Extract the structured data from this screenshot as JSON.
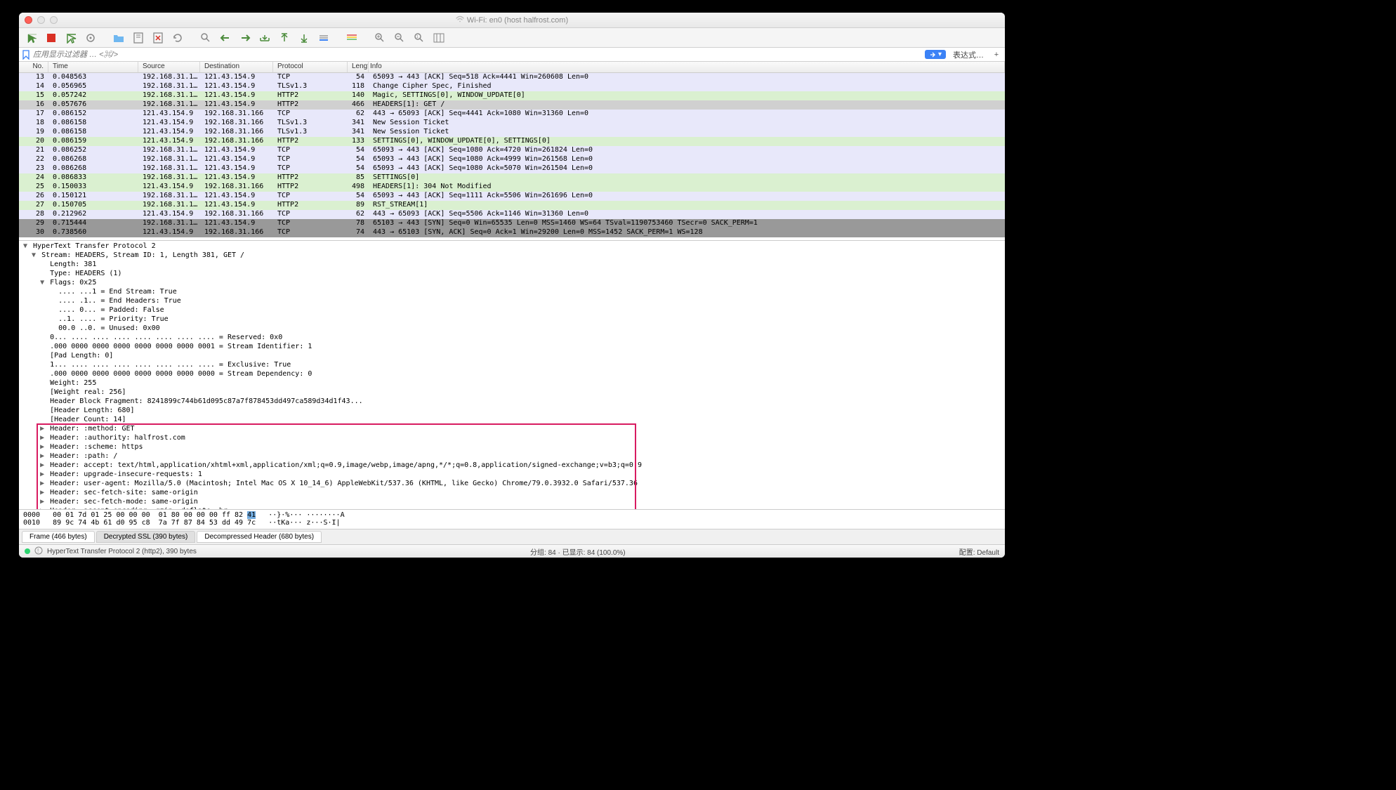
{
  "title": "Wi-Fi: en0 (host halfrost.com)",
  "filter_placeholder": "应用显示过滤器 … <⌘/>",
  "expr_label": "表达式…",
  "columns": [
    "No.",
    "Time",
    "Source",
    "Destination",
    "Protocol",
    "Length",
    "Info"
  ],
  "packets": [
    {
      "no": 13,
      "time": "0.048563",
      "src": "192.168.31.1…",
      "dst": "121.43.154.9",
      "proto": "TCP",
      "len": 54,
      "info": "65093 → 443 [ACK] Seq=518 Ack=4441 Win=260608 Len=0",
      "bg": "lav"
    },
    {
      "no": 14,
      "time": "0.056965",
      "src": "192.168.31.1…",
      "dst": "121.43.154.9",
      "proto": "TLSv1.3",
      "len": 118,
      "info": "Change Cipher Spec, Finished",
      "bg": "lav"
    },
    {
      "no": 15,
      "time": "0.057242",
      "src": "192.168.31.1…",
      "dst": "121.43.154.9",
      "proto": "HTTP2",
      "len": 140,
      "info": "Magic, SETTINGS[0], WINDOW_UPDATE[0]",
      "bg": "gr"
    },
    {
      "no": 16,
      "time": "0.057676",
      "src": "192.168.31.1…",
      "dst": "121.43.154.9",
      "proto": "HTTP2",
      "len": 466,
      "info": "HEADERS[1]: GET /",
      "bg": "sel"
    },
    {
      "no": 17,
      "time": "0.086152",
      "src": "121.43.154.9",
      "dst": "192.168.31.166",
      "proto": "TCP",
      "len": 62,
      "info": "443 → 65093 [ACK] Seq=4441 Ack=1080 Win=31360 Len=0",
      "bg": "lav"
    },
    {
      "no": 18,
      "time": "0.086158",
      "src": "121.43.154.9",
      "dst": "192.168.31.166",
      "proto": "TLSv1.3",
      "len": 341,
      "info": "New Session Ticket",
      "bg": "lav"
    },
    {
      "no": 19,
      "time": "0.086158",
      "src": "121.43.154.9",
      "dst": "192.168.31.166",
      "proto": "TLSv1.3",
      "len": 341,
      "info": "New Session Ticket",
      "bg": "lav"
    },
    {
      "no": 20,
      "time": "0.086159",
      "src": "121.43.154.9",
      "dst": "192.168.31.166",
      "proto": "HTTP2",
      "len": 133,
      "info": "SETTINGS[0], WINDOW_UPDATE[0], SETTINGS[0]",
      "bg": "gr"
    },
    {
      "no": 21,
      "time": "0.086252",
      "src": "192.168.31.1…",
      "dst": "121.43.154.9",
      "proto": "TCP",
      "len": 54,
      "info": "65093 → 443 [ACK] Seq=1080 Ack=4720 Win=261824 Len=0",
      "bg": "lav"
    },
    {
      "no": 22,
      "time": "0.086268",
      "src": "192.168.31.1…",
      "dst": "121.43.154.9",
      "proto": "TCP",
      "len": 54,
      "info": "65093 → 443 [ACK] Seq=1080 Ack=4999 Win=261568 Len=0",
      "bg": "lav"
    },
    {
      "no": 23,
      "time": "0.086268",
      "src": "192.168.31.1…",
      "dst": "121.43.154.9",
      "proto": "TCP",
      "len": 54,
      "info": "65093 → 443 [ACK] Seq=1080 Ack=5070 Win=261504 Len=0",
      "bg": "lav"
    },
    {
      "no": 24,
      "time": "0.086833",
      "src": "192.168.31.1…",
      "dst": "121.43.154.9",
      "proto": "HTTP2",
      "len": 85,
      "info": "SETTINGS[0]",
      "bg": "gr"
    },
    {
      "no": 25,
      "time": "0.150033",
      "src": "121.43.154.9",
      "dst": "192.168.31.166",
      "proto": "HTTP2",
      "len": 498,
      "info": "HEADERS[1]: 304 Not Modified",
      "bg": "gr"
    },
    {
      "no": 26,
      "time": "0.150121",
      "src": "192.168.31.1…",
      "dst": "121.43.154.9",
      "proto": "TCP",
      "len": 54,
      "info": "65093 → 443 [ACK] Seq=1111 Ack=5506 Win=261696 Len=0",
      "bg": "lav"
    },
    {
      "no": 27,
      "time": "0.150705",
      "src": "192.168.31.1…",
      "dst": "121.43.154.9",
      "proto": "HTTP2",
      "len": 89,
      "info": "RST_STREAM[1]",
      "bg": "gr"
    },
    {
      "no": 28,
      "time": "0.212962",
      "src": "121.43.154.9",
      "dst": "192.168.31.166",
      "proto": "TCP",
      "len": 62,
      "info": "443 → 65093 [ACK] Seq=5506 Ack=1146 Win=31360 Len=0",
      "bg": "lav"
    },
    {
      "no": 29,
      "time": "0.715444",
      "src": "192.168.31.1…",
      "dst": "121.43.154.9",
      "proto": "TCP",
      "len": 78,
      "info": "65103 → 443 [SYN] Seq=0 Win=65535 Len=0 MSS=1460 WS=64 TSval=1190753460 TSecr=0 SACK_PERM=1",
      "bg": "dark"
    },
    {
      "no": 30,
      "time": "0.738560",
      "src": "121.43.154.9",
      "dst": "192.168.31.166",
      "proto": "TCP",
      "len": 74,
      "info": "443 → 65103 [SYN, ACK] Seq=0 Ack=1 Win=29200 Len=0 MSS=1452 SACK_PERM=1 WS=128",
      "bg": "dark"
    }
  ],
  "details": [
    {
      "ind": 0,
      "tw": "▼",
      "t": "HyperText Transfer Protocol 2"
    },
    {
      "ind": 1,
      "tw": "▼",
      "t": "Stream: HEADERS, Stream ID: 1, Length 381, GET /"
    },
    {
      "ind": 2,
      "tw": " ",
      "t": "Length: 381"
    },
    {
      "ind": 2,
      "tw": " ",
      "t": "Type: HEADERS (1)"
    },
    {
      "ind": 2,
      "tw": "▼",
      "t": "Flags: 0x25"
    },
    {
      "ind": 3,
      "tw": " ",
      "t": ".... ...1 = End Stream: True"
    },
    {
      "ind": 3,
      "tw": " ",
      "t": ".... .1.. = End Headers: True"
    },
    {
      "ind": 3,
      "tw": " ",
      "t": ".... 0... = Padded: False"
    },
    {
      "ind": 3,
      "tw": " ",
      "t": "..1. .... = Priority: True"
    },
    {
      "ind": 3,
      "tw": " ",
      "t": "00.0 ..0. = Unused: 0x00"
    },
    {
      "ind": 2,
      "tw": " ",
      "t": "0... .... .... .... .... .... .... .... = Reserved: 0x0"
    },
    {
      "ind": 2,
      "tw": " ",
      "t": ".000 0000 0000 0000 0000 0000 0000 0001 = Stream Identifier: 1"
    },
    {
      "ind": 2,
      "tw": " ",
      "t": "[Pad Length: 0]"
    },
    {
      "ind": 2,
      "tw": " ",
      "t": "1... .... .... .... .... .... .... .... = Exclusive: True"
    },
    {
      "ind": 2,
      "tw": " ",
      "t": ".000 0000 0000 0000 0000 0000 0000 0000 = Stream Dependency: 0"
    },
    {
      "ind": 2,
      "tw": " ",
      "t": "Weight: 255"
    },
    {
      "ind": 2,
      "tw": " ",
      "t": "[Weight real: 256]"
    },
    {
      "ind": 2,
      "tw": " ",
      "t": "Header Block Fragment: 8241899c744b61d095c87a7f878453dd497ca589d34d1f43..."
    },
    {
      "ind": 2,
      "tw": " ",
      "t": "[Header Length: 680]"
    },
    {
      "ind": 2,
      "tw": " ",
      "t": "[Header Count: 14]"
    },
    {
      "ind": 2,
      "tw": "▶",
      "t": "Header: :method: GET",
      "hl": true
    },
    {
      "ind": 2,
      "tw": "▶",
      "t": "Header: :authority: halfrost.com",
      "hl": true
    },
    {
      "ind": 2,
      "tw": "▶",
      "t": "Header: :scheme: https",
      "hl": true
    },
    {
      "ind": 2,
      "tw": "▶",
      "t": "Header: :path: /",
      "hl": true
    },
    {
      "ind": 2,
      "tw": "▶",
      "t": "Header: accept: text/html,application/xhtml+xml,application/xml;q=0.9,image/webp,image/apng,*/*;q=0.8,application/signed-exchange;v=b3;q=0.9",
      "hl": true
    },
    {
      "ind": 2,
      "tw": "▶",
      "t": "Header: upgrade-insecure-requests: 1",
      "hl": true
    },
    {
      "ind": 2,
      "tw": "▶",
      "t": "Header: user-agent: Mozilla/5.0 (Macintosh; Intel Mac OS X 10_14_6) AppleWebKit/537.36 (KHTML, like Gecko) Chrome/79.0.3932.0 Safari/537.36",
      "hl": true
    },
    {
      "ind": 2,
      "tw": "▶",
      "t": "Header: sec-fetch-site: same-origin",
      "hl": true
    },
    {
      "ind": 2,
      "tw": "▶",
      "t": "Header: sec-fetch-mode: same-origin",
      "hl": true
    },
    {
      "ind": 2,
      "tw": "▶",
      "t": "Header: accept-encoding: gzip, deflate, br",
      "hl": true
    }
  ],
  "hex": {
    "l1_off": "0000",
    "l1_hex": "00 01 7d 01 25 00 00 00  01 80 00 00 00 ff 82 ",
    "l1_hl": "41",
    "l1_asc": "   ··}·%··· ········A",
    "l2_off": "0010",
    "l2_hex": "89 9c 74 4b 61 d0 95 c8  7a 7f 87 84 53 dd 49 7c",
    "l2_asc": "   ··tKa··· z···S·I|"
  },
  "tabs": [
    "Frame (466 bytes)",
    "Decrypted SSL (390 bytes)",
    "Decompressed Header (680 bytes)"
  ],
  "status": {
    "left": "HyperText Transfer Protocol 2 (http2), 390 bytes",
    "mid": "分组: 84 · 已显示: 84 (100.0%)",
    "right": "配置: Default"
  }
}
